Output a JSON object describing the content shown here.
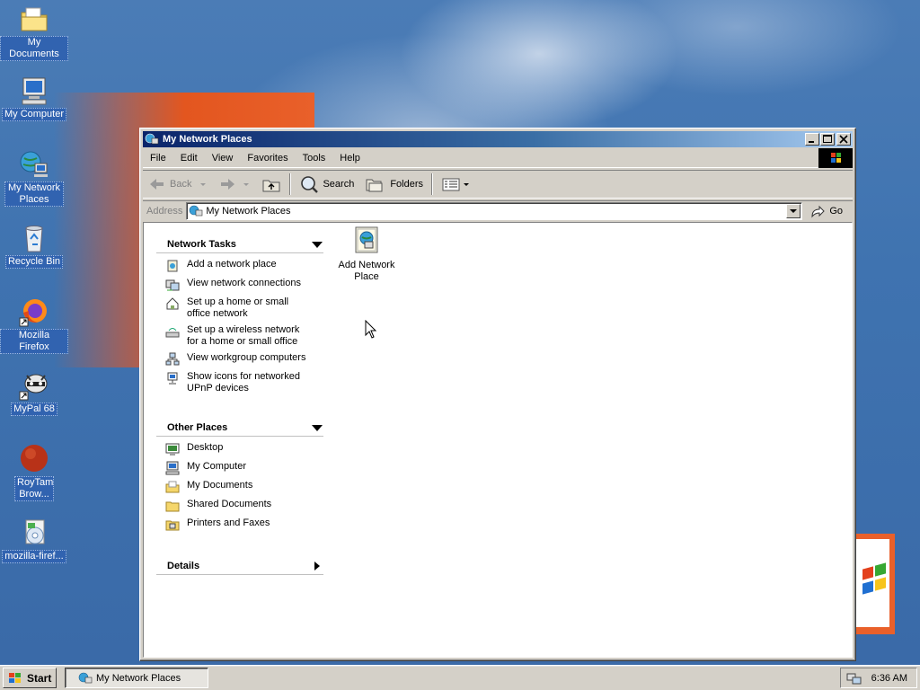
{
  "desktop": {
    "icons": [
      {
        "label": "My Documents",
        "icon": "folder-documents-icon"
      },
      {
        "label": "My Computer",
        "icon": "computer-icon"
      },
      {
        "label": "My Network Places",
        "icon": "network-places-icon"
      },
      {
        "label": "Recycle Bin",
        "icon": "recycle-bin-icon"
      },
      {
        "label": "Mozilla Firefox",
        "icon": "firefox-icon"
      },
      {
        "label": "MyPal 68",
        "icon": "mypal-icon"
      },
      {
        "label": "RoyTam Brow...",
        "icon": "roytam-browser-icon"
      },
      {
        "label": "mozilla-firef...",
        "icon": "installer-icon"
      }
    ]
  },
  "window": {
    "title": "My Network Places",
    "menu": [
      "File",
      "Edit",
      "View",
      "Favorites",
      "Tools",
      "Help"
    ],
    "toolbar": {
      "back": "Back",
      "search": "Search",
      "folders": "Folders"
    },
    "address": {
      "label": "Address",
      "value": "My Network Places",
      "go": "Go"
    },
    "network_tasks": {
      "title": "Network Tasks",
      "items": [
        "Add a network place",
        "View network connections",
        "Set up a home or small office network",
        "Set up a wireless network for a home or small office",
        "View workgroup computers",
        "Show icons for networked UPnP devices"
      ]
    },
    "other_places": {
      "title": "Other Places",
      "items": [
        "Desktop",
        "My Computer",
        "My Documents",
        "Shared Documents",
        "Printers and Faxes"
      ]
    },
    "details": {
      "title": "Details"
    },
    "content": {
      "items": [
        {
          "label": "Add Network Place"
        }
      ]
    }
  },
  "taskbar": {
    "start": "Start",
    "task": "My Network Places",
    "clock": "6:36 AM"
  },
  "colors": {
    "title_active_start": "#0a246a",
    "title_active_end": "#a6caf0",
    "desktop_blue": "#3a6ea5",
    "face": "#d4d0c8"
  }
}
